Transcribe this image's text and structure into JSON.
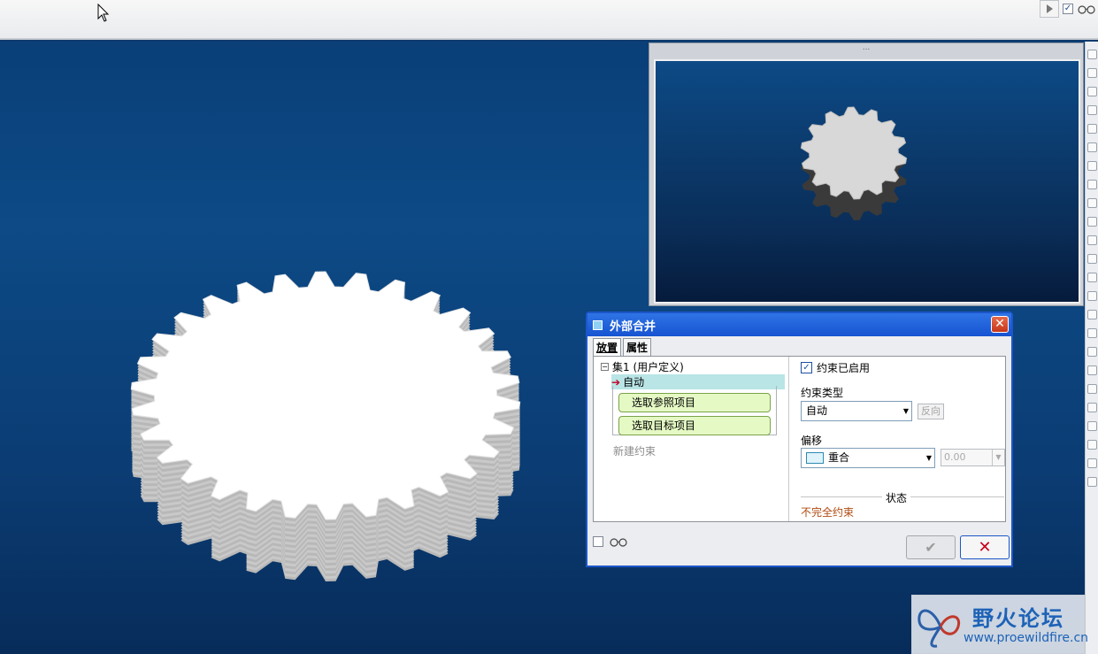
{
  "toolbar": {
    "play_icon": "play-icon",
    "checkbox_checked": true,
    "glasses_icon": "glasses-icon"
  },
  "dialog": {
    "title": "外部合并",
    "close_label": "✕",
    "tabs": [
      {
        "label": "放置"
      },
      {
        "label": "属性"
      }
    ],
    "tree": {
      "set_label": "集1 (用户定义)",
      "expander": "−",
      "auto_label": "自动",
      "select_ref": "选取参照项目",
      "select_target": "选取目标项目",
      "new_constraint": "新建约束"
    },
    "constraint_enabled": {
      "label": "约束已启用",
      "checked": true
    },
    "constraint_type": {
      "label": "约束类型",
      "value": "自动",
      "reverse_btn": "反向"
    },
    "offset": {
      "label": "偏移",
      "value": "重合",
      "input_value": "0.00"
    },
    "status": {
      "label": "状态",
      "text": "不完全约束"
    },
    "ok_label": "✔",
    "cancel_label": "✕"
  },
  "preview": {
    "grip": "..."
  },
  "watermark": {
    "title": "野火论坛",
    "url": "www.proewildfire.cn"
  },
  "colors": {
    "viewport_bg": "#0d4a86",
    "dialog_title": "#1653d1",
    "status_text": "#b04a10"
  }
}
